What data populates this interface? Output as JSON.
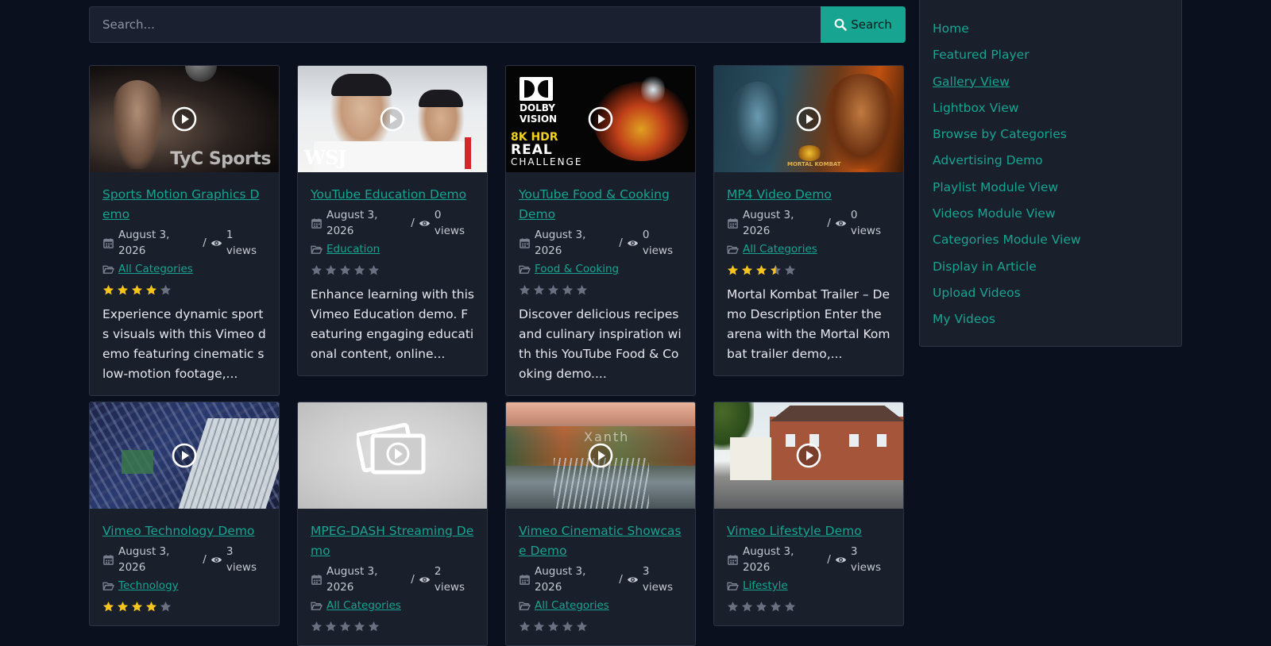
{
  "search": {
    "placeholder": "Search...",
    "button_label": "Search"
  },
  "videos": [
    {
      "title": "Sports Motion Graphics Demo",
      "date": "August 3, 2026",
      "views": "1 views",
      "category": "All Categories",
      "rating": 4,
      "thumb_text": "TyC Sports",
      "description": "Experience dynamic sports visuals with this Vimeo demo featuring cinematic slow-motion footage,..."
    },
    {
      "title": "YouTube Education Demo",
      "date": "August 3, 2026",
      "views": "0 views",
      "category": "Education",
      "rating": 0,
      "thumb_text": "WSJ",
      "description": "Enhance learning with this Vimeo Education demo. Featuring engaging educational content, online..."
    },
    {
      "title": "YouTube Food & Cooking Demo",
      "date": "August 3, 2026",
      "views": "0 views",
      "category": "Food & Cooking",
      "rating": 0,
      "thumb_text": "DOLBY VISION",
      "thumb_text_2": "8K HDR",
      "thumb_text_3": "REAL",
      "thumb_text_4": "CHALLENGE",
      "description": "Discover delicious recipes and culinary inspiration with this YouTube Food & Cooking demo...."
    },
    {
      "title": "MP4 Video Demo",
      "date": "August 3, 2026",
      "views": "0 views",
      "category": "All Categories",
      "rating": 3.5,
      "thumb_text": "MORTAL KOMBAT",
      "description": "Mortal Kombat Trailer – Demo Description Enter the arena with the Mortal Kombat trailer demo,..."
    },
    {
      "title": "Vimeo Technology Demo",
      "date": "August 3, 2026",
      "views": "3 views",
      "category": "Technology",
      "rating": 4
    },
    {
      "title": "MPEG-DASH Streaming Demo",
      "date": "August 3, 2026",
      "views": "2 views",
      "category": "All Categories",
      "rating": 0
    },
    {
      "title": "Vimeo Cinematic Showcase Demo",
      "date": "August 3, 2026",
      "views": "3 views",
      "category": "All Categories",
      "rating": 0,
      "thumb_text": "Xanth"
    },
    {
      "title": "Vimeo Lifestyle Demo",
      "date": "August 3, 2026",
      "views": "3 views",
      "category": "Lifestyle",
      "rating": 0
    }
  ],
  "sidebar": {
    "items": [
      {
        "label": "Home"
      },
      {
        "label": "Featured Player"
      },
      {
        "label": "Gallery View",
        "active": true
      },
      {
        "label": "Lightbox View"
      },
      {
        "label": "Browse by Categories"
      },
      {
        "label": "Advertising Demo"
      },
      {
        "label": "Playlist Module View"
      },
      {
        "label": "Videos Module View"
      },
      {
        "label": "Categories Module View"
      },
      {
        "label": "Display in Article"
      },
      {
        "label": "Upload Videos"
      },
      {
        "label": "My Videos"
      }
    ]
  },
  "icons": {
    "search": "search-icon",
    "date": "calendar-icon",
    "views": "eye-icon",
    "category": "folder-icon",
    "play": "play-icon",
    "star": "star-icon"
  },
  "colors": {
    "background": "#0b101e",
    "card": "#1a1f2c",
    "accent": "#17a591",
    "star_filled": "#f5c518",
    "star_empty": "#6b7080"
  }
}
